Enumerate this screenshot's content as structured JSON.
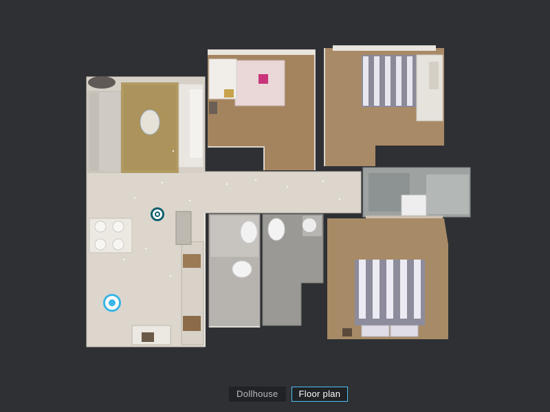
{
  "viewer": {
    "modes": [
      {
        "label": "Dollhouse",
        "active": false
      },
      {
        "label": "Floor plan",
        "active": true
      }
    ]
  },
  "icons": {
    "sweep_current": "sweep-marker-icon",
    "sweep_selected": "sweep-marker-selected-icon"
  },
  "colors": {
    "background": "#2e3034",
    "accent": "#4fc3f7",
    "sweep_selected": "#38b6e8"
  }
}
